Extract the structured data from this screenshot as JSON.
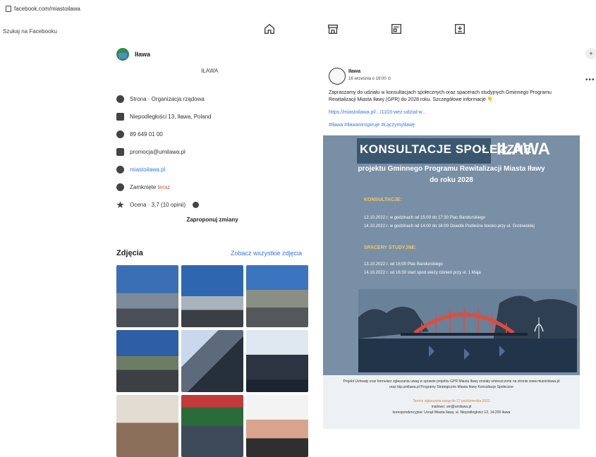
{
  "browser": {
    "url": "facebook.com/miastoilawa"
  },
  "fb_search": {
    "placeholder": "Szukaj na Facebooku"
  },
  "nav": [
    {
      "icon": "home-icon"
    },
    {
      "icon": "marketplace-icon"
    },
    {
      "icon": "pages-icon"
    },
    {
      "icon": "gaming-icon"
    }
  ],
  "page": {
    "name": "Iława",
    "subtitle": "IŁAWA",
    "info": {
      "category": "Strona · Organizacja rządowa",
      "address": "Niepodległości 13, Iława, Poland",
      "phone": "89 649 01 00",
      "email": "promocja@umilawa.pl",
      "website": "miastoilawa.pl",
      "hours_prefix": "Zamknięte",
      "hours_suffix": " teraz",
      "rating": "Ocena · 3,7 (10 opinii)"
    },
    "suggest_label": "Zaproponuj zmiany"
  },
  "photos": {
    "title": "Zdjęcia",
    "see_all": "Zobacz wszystkie zdjęcia"
  },
  "post": {
    "author": "Iława",
    "date": "16 września o 19:00",
    "text": "Zapraszamy do udziału w konsultacjach społecznych oraz spacerach studyjnych Gminnego Programu Rewitalizacji Miasta Iławy (GPR) do 2028 roku. Szczegółowe informacje 👇",
    "link": "https://miastoilawa.pl/.../1103-wez-udzial-w...",
    "tags": "#Iława #Iławaninspiruje #ŁączymyIławę"
  },
  "poster": {
    "title_a": "KONSULTACJE SPOŁECZNE",
    "title_b": "IŁAWA",
    "subtitle_1": "projektu Gminnego Programu Rewitalizacji Miasta Iławy",
    "subtitle_2": "do roku 2028",
    "sec1": "KONSULTACJE:",
    "sec1_l1": "12.10.2022 r. w godzinach od 15:00 do 17:30 Plac Bandurskiego",
    "sec1_l2": "14.10.2022 r. w godzinach od 14:00 do 16:00 Osiedle Podleśne boisko przy ul. Grotowskiej",
    "sec2": "SPACERY STUDYJNE:",
    "sec2_l1": "13.10.2022 r. od 16:00 Plac Bandurskiego",
    "sec2_l2": "14.10.2022 r. od 16:30 start spod wieży ciśnień przy ul. 1 Maja",
    "strip_1": "Projekt Uchwały oraz formularz zgłaszania uwag w sprawie projektu GPR Miasta Iławy zostały umieszczone na stronie www.miastoilawa.pl",
    "strip_2": "oraz bip.umilawa.pl Programy Strategiczne Miasta Iławy Konsultacje Społeczne",
    "strip_3": "Termin zgłaszania uwag do 17 października 2022",
    "strip_4": "mailowo: um@umilawa.pl",
    "strip_5": "korespondencyjnie: Urząd Miasta Iławy, ul. Niepodległości 13, 14-200 Iława"
  }
}
